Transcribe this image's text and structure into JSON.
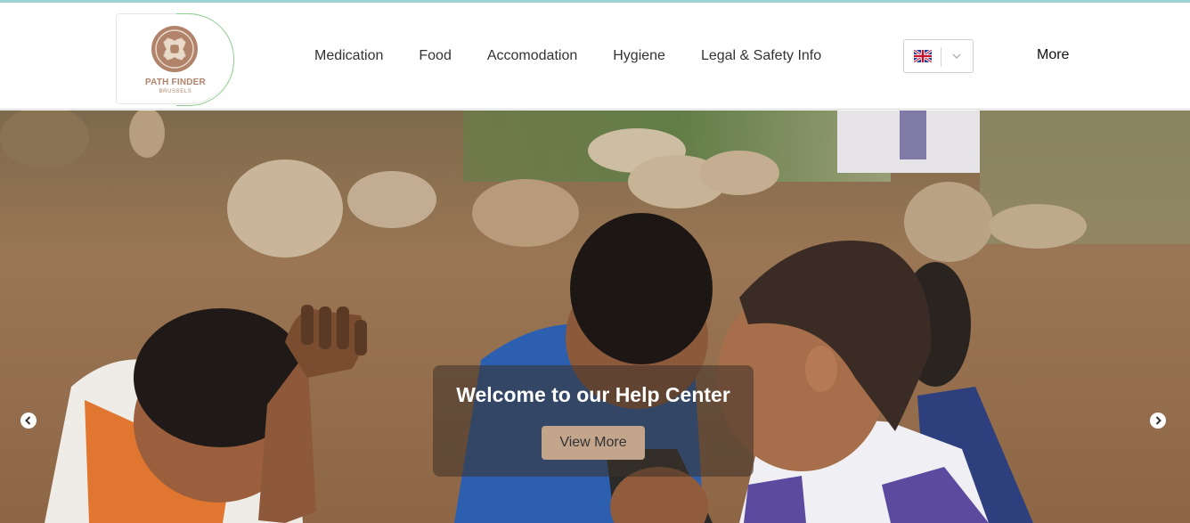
{
  "brand": {
    "name": "PATH FINDER",
    "city": "BRUSSELS",
    "icon": "helping-hands-logo"
  },
  "nav": {
    "items": [
      {
        "label": "Medication"
      },
      {
        "label": "Food"
      },
      {
        "label": "Accomodation"
      },
      {
        "label": "Hygiene"
      },
      {
        "label": "Legal & Safety Info"
      }
    ],
    "language": {
      "flag_icon": "uk-flag-icon",
      "dropdown_icon": "chevron-down-icon"
    },
    "more_label": "More"
  },
  "hero": {
    "title": "Welcome to our Help Center",
    "button_label": "View More",
    "prev_icon": "chevron-left-icon",
    "next_icon": "chevron-right-icon"
  },
  "colors": {
    "accent": "#c3a58c",
    "brand": "#b0836a",
    "top_line": "#9fd3d6"
  }
}
